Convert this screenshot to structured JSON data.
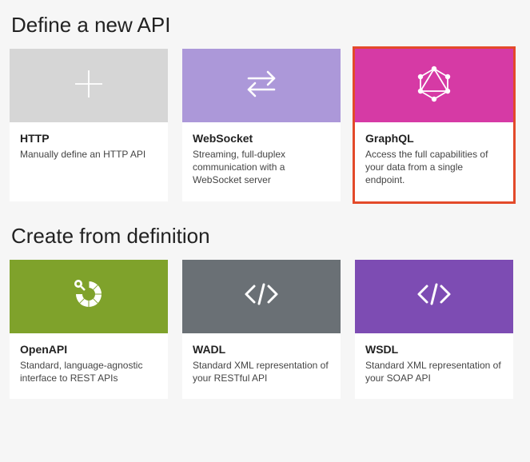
{
  "sections": {
    "define": {
      "heading": "Define a new API",
      "cards": {
        "http": {
          "title": "HTTP",
          "desc": "Manually define an HTTP API"
        },
        "websocket": {
          "title": "WebSocket",
          "desc": "Streaming, full-duplex communication with a WebSocket server"
        },
        "graphql": {
          "title": "GraphQL",
          "desc": "Access the full capabilities of your data from a single endpoint."
        }
      }
    },
    "create": {
      "heading": "Create from definition",
      "cards": {
        "openapi": {
          "title": "OpenAPI",
          "desc": "Standard, language-agnostic interface to REST APIs"
        },
        "wadl": {
          "title": "WADL",
          "desc": "Standard XML representation of your RESTful API"
        },
        "wsdl": {
          "title": "WSDL",
          "desc": "Standard XML representation of your SOAP API"
        }
      }
    }
  },
  "selected_card": "graphql",
  "colors": {
    "highlight": "#e34a2a",
    "http": "#d6d6d6",
    "websocket": "#ac98d9",
    "graphql": "#d63aa5",
    "openapi": "#7fa22b",
    "wadl": "#6a7075",
    "wsdl": "#7d4cb3"
  }
}
